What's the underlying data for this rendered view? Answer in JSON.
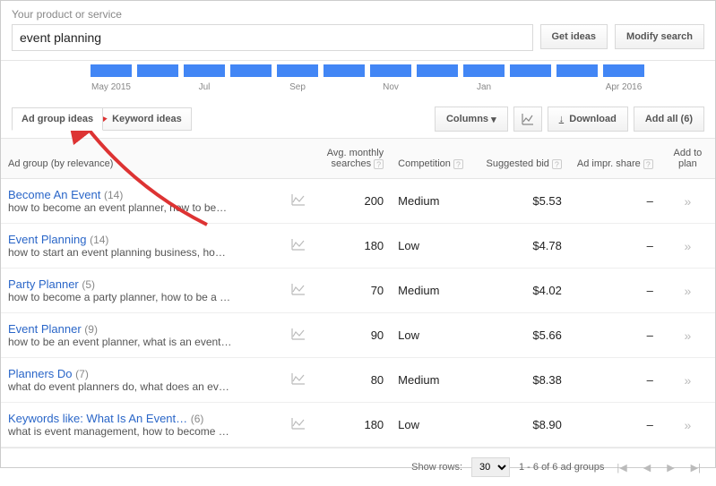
{
  "header": {
    "label": "Your product or service",
    "input_value": "event planning",
    "get_ideas": "Get ideas",
    "modify_search": "Modify search"
  },
  "chart": {
    "ticks": [
      "May 2015",
      "Jul",
      "Sep",
      "Nov",
      "Jan",
      "Apr 2016"
    ]
  },
  "toolbar": {
    "tab_ad_group": "Ad group ideas",
    "tab_keyword": "Keyword ideas",
    "columns": "Columns",
    "download": "Download",
    "add_all": "Add all (6)"
  },
  "table": {
    "headers": {
      "group": "Ad group (by relevance)",
      "avg": "Avg. monthly searches",
      "comp": "Competition",
      "bid": "Suggested bid",
      "share": "Ad impr. share",
      "add": "Add to plan"
    },
    "rows": [
      {
        "title": "Become An Event",
        "count": "(14)",
        "desc": "how to become an event planner, how to be…",
        "avg": "200",
        "comp": "Medium",
        "bid": "$5.53",
        "share": "–"
      },
      {
        "title": "Event Planning",
        "count": "(14)",
        "desc": "how to start an event planning business, ho…",
        "avg": "180",
        "comp": "Low",
        "bid": "$4.78",
        "share": "–"
      },
      {
        "title": "Party Planner",
        "count": "(5)",
        "desc": "how to become a party planner, how to be a …",
        "avg": "70",
        "comp": "Medium",
        "bid": "$4.02",
        "share": "–"
      },
      {
        "title": "Event Planner",
        "count": "(9)",
        "desc": "how to be an event planner, what is an event…",
        "avg": "90",
        "comp": "Low",
        "bid": "$5.66",
        "share": "–"
      },
      {
        "title": "Planners Do",
        "count": "(7)",
        "desc": "what do event planners do, what does an ev…",
        "avg": "80",
        "comp": "Medium",
        "bid": "$8.38",
        "share": "–"
      },
      {
        "title": "Keywords like: What Is An Event…",
        "count": "(6)",
        "desc": "what is event management, how to become …",
        "avg": "180",
        "comp": "Low",
        "bid": "$8.90",
        "share": "–"
      }
    ]
  },
  "pager": {
    "show_rows": "Show rows:",
    "rows_value": "30",
    "range": "1 - 6 of 6 ad groups"
  }
}
